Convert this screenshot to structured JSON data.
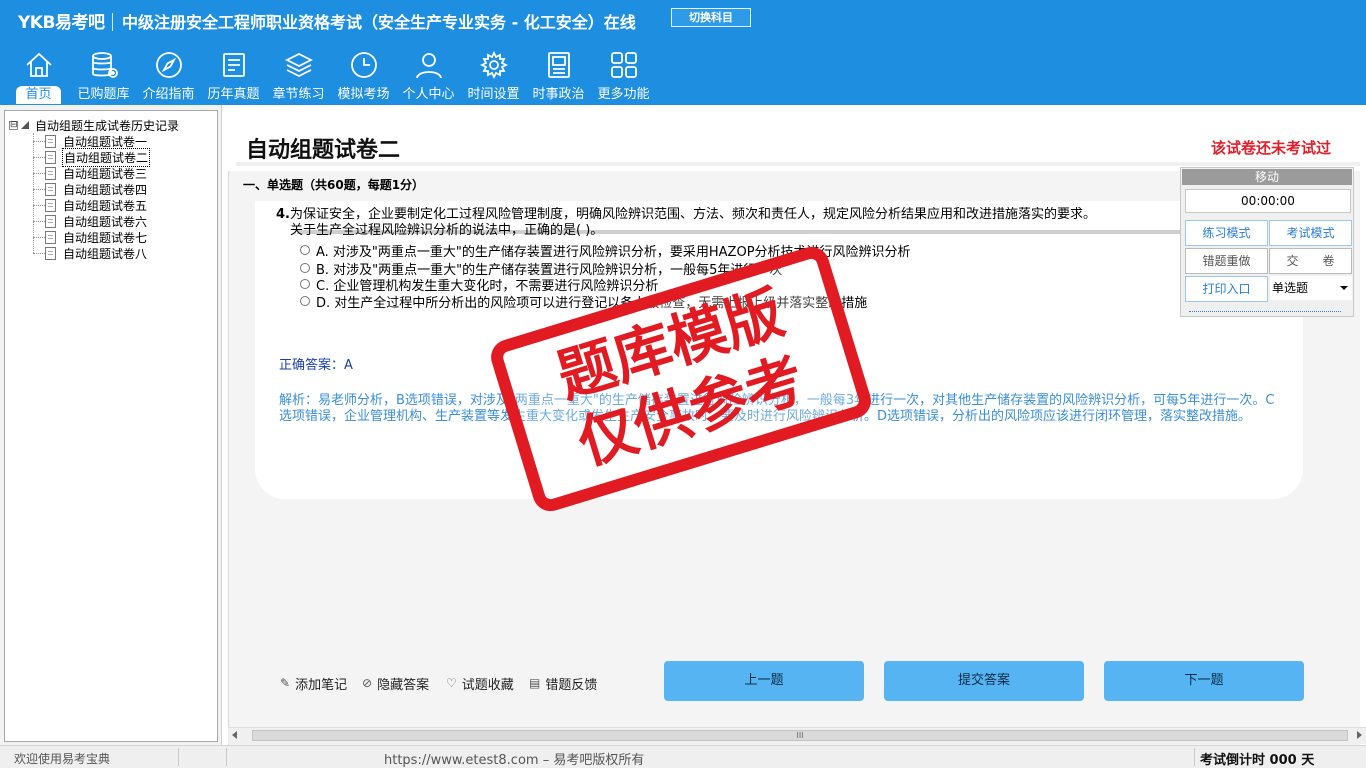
{
  "header": {
    "logo": "YKB易考吧",
    "exam_title": "中级注册安全工程师职业资格考试（安全生产专业实务 - 化工安全）在线",
    "switch_label": "切换科目",
    "nav": [
      {
        "label": "首页",
        "icon": "home-icon",
        "active": true
      },
      {
        "label": "已购题库",
        "icon": "database-icon"
      },
      {
        "label": "介绍指南",
        "icon": "compass-icon"
      },
      {
        "label": "历年真题",
        "icon": "notes-icon"
      },
      {
        "label": "章节练习",
        "icon": "layers-icon"
      },
      {
        "label": "模拟考场",
        "icon": "clock-icon"
      },
      {
        "label": "个人中心",
        "icon": "user-icon"
      },
      {
        "label": "时间设置",
        "icon": "gear-icon"
      },
      {
        "label": "时事政治",
        "icon": "newspaper-icon"
      },
      {
        "label": "更多功能",
        "icon": "grid-icon"
      }
    ]
  },
  "tree": {
    "toggle": "⊟",
    "root": "自动组题生成试卷历史记录",
    "items": [
      "自动组题试卷一",
      "自动组题试卷二",
      "自动组题试卷三",
      "自动组题试卷四",
      "自动组题试卷五",
      "自动组题试卷六",
      "自动组题试卷七",
      "自动组题试卷八"
    ],
    "selected_index": 1
  },
  "paper": {
    "title": "自动组题试卷二",
    "status": "该试卷还未考试过",
    "section": "一、单选题（共60题，每题1分）"
  },
  "question": {
    "number": "4.",
    "line1": "为保证安全，企业要制定化工过程风险管理制度，明确风险辨识范围、方法、频次和责任人，规定风险分析结果应用和改进措施落实的要求。",
    "line2": "关于生产全过程风险辨识分析的说法中，正确的是(  )。",
    "options": [
      "A. 对涉及\"两重点一重大\"的生产储存装置进行风险辨识分析，要采用HAZOP分析技术进行风险辨识分析",
      "B. 对涉及\"两重点一重大\"的生产储存装置进行风险辨识分析，一般每5年进行一次",
      "C. 企业管理机构发生重大变化时，不需要进行风险辨识分析",
      "D. 对生产全过程中所分析出的风险项可以进行登记以备上级检查，无需上报上级并落实整改措施"
    ],
    "answer_label": "正确答案：",
    "answer": "A",
    "analysis": "解析：易老师分析，B选项错误，对涉及\"两重点一重大\"的生产储存装置进行风险辨识分析，一般每3年进行一次，对其他生产储存装置的风险辨识分析，可每5年进行一次。C选项错误，企业管理机构、生产装置等发生重大变化或发生生产安全事故时，要及时进行风险辨识分析。D选项错误，分析出的风险项应该进行闭环管理，落实整改措施。"
  },
  "control": {
    "move": "移动",
    "timer": "00:00:00",
    "practice_mode": "练习模式",
    "exam_mode": "考试模式",
    "redo_wrong": "错题重做",
    "submit_paper": "交　　卷",
    "print": "打印入口",
    "type_select": "单选题"
  },
  "watermark": {
    "line1": "题库模版",
    "line2": "仅供参考"
  },
  "tools": {
    "note": "添加笔记",
    "hide": "隐藏答案",
    "fav": "试题收藏",
    "feedback": "错题反馈"
  },
  "buttons": {
    "prev": "上一题",
    "submit": "提交答案",
    "next": "下一题"
  },
  "scroll": {
    "grip": "III"
  },
  "status": {
    "welcome": "欢迎使用易考宝典",
    "url": "https://www.etest8.com – 易考吧版权所有",
    "countdown": "考试倒计时 000 天"
  }
}
